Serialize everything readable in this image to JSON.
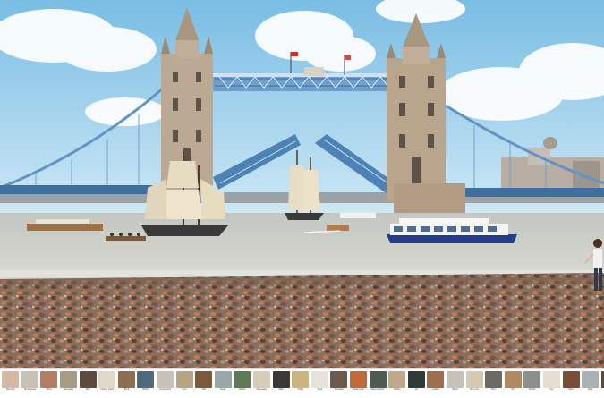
{
  "page": {
    "caption_labels": [
      "Clay pipe",
      "Tile fragment",
      "Bone",
      "Sea glass",
      "Flint",
      "Pottery shard",
      "Brick",
      "Button",
      "Oyster shell",
      "Coin",
      "Nail",
      "Bead",
      "Marble",
      "Stoneware",
      "Slate",
      "Chalk",
      "Shell",
      "Porcelain",
      "Metal scrap",
      "Glass stopper",
      "Pebble",
      "Jet",
      "Leather",
      "Wood",
      "Flint core",
      "Horn",
      "Pin",
      "Buckle",
      "Key",
      "Token",
      "Ring",
      "Hook"
    ]
  },
  "colors": {
    "sky_top": "#7fc4e8",
    "sky_bottom": "#c9e6f4",
    "tower_stone": "#b9a48c",
    "bridge_blue": "#5c8fc6",
    "river": "#c7cbc7",
    "foreshore": "#8a6f5d"
  },
  "tiles": [
    {
      "color": "#d7b7a4"
    },
    {
      "color": "#c7c1b7"
    },
    {
      "color": "#b37c63"
    },
    {
      "color": "#a79c82"
    },
    {
      "color": "#5d4b3e"
    },
    {
      "color": "#e0d7c8"
    },
    {
      "color": "#8e6e50"
    },
    {
      "color": "#4d6b7c"
    },
    {
      "color": "#c7c1b7"
    },
    {
      "color": "#b8a382"
    },
    {
      "color": "#7b5a3c"
    },
    {
      "color": "#9aa6a7"
    },
    {
      "color": "#5f7b55"
    },
    {
      "color": "#d8cdb7"
    },
    {
      "color": "#3d3835"
    },
    {
      "color": "#cbb47f"
    },
    {
      "color": "#e7e2da"
    },
    {
      "color": "#6c5a4c"
    },
    {
      "color": "#c06a3b"
    },
    {
      "color": "#4e5b55"
    },
    {
      "color": "#bfa78a"
    },
    {
      "color": "#2f3b39"
    },
    {
      "color": "#9e6d4a"
    },
    {
      "color": "#c7c1b7"
    },
    {
      "color": "#d6c9b0"
    },
    {
      "color": "#6c6a60"
    },
    {
      "color": "#b08a5e"
    },
    {
      "color": "#8d8f8b"
    },
    {
      "color": "#e6dfd1"
    },
    {
      "color": "#7a4d35"
    },
    {
      "color": "#a8b2b2"
    },
    {
      "color": "#5a4a3d"
    }
  ]
}
